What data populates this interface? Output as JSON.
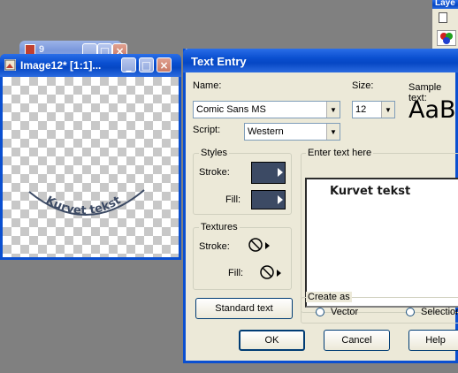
{
  "background_window": {
    "title": "9"
  },
  "image_window": {
    "title": "Image12* [1:1]...",
    "curved_text": "Kurvet tekst"
  },
  "layers_window": {
    "title": "Laye"
  },
  "text_entry": {
    "title": "Text Entry",
    "name_label": "Name:",
    "name_value": "Comic Sans MS",
    "size_label": "Size:",
    "size_value": "12",
    "sample_label": "Sample text:",
    "sample_text": "AaBl",
    "script_label": "Script:",
    "script_value": "Western",
    "styles": {
      "label": "Styles",
      "stroke_label": "Stroke:",
      "fill_label": "Fill:",
      "color": "#3c4a64"
    },
    "textures": {
      "label": "Textures",
      "stroke_label": "Stroke:",
      "fill_label": "Fill:"
    },
    "enter_text_label": "Enter text here",
    "entered_text": "Kurvet tekst",
    "standard_text_button": "Standard text",
    "create_as": {
      "label": "Create as",
      "vector": "Vector",
      "selection": "Selection"
    },
    "ok_button": "OK",
    "cancel_button": "Cancel",
    "help_button": "Help"
  },
  "colors": {
    "desktop": "#808080",
    "titlebar_active": "#0a4fd0",
    "dialog_bg": "#ece9d8"
  }
}
